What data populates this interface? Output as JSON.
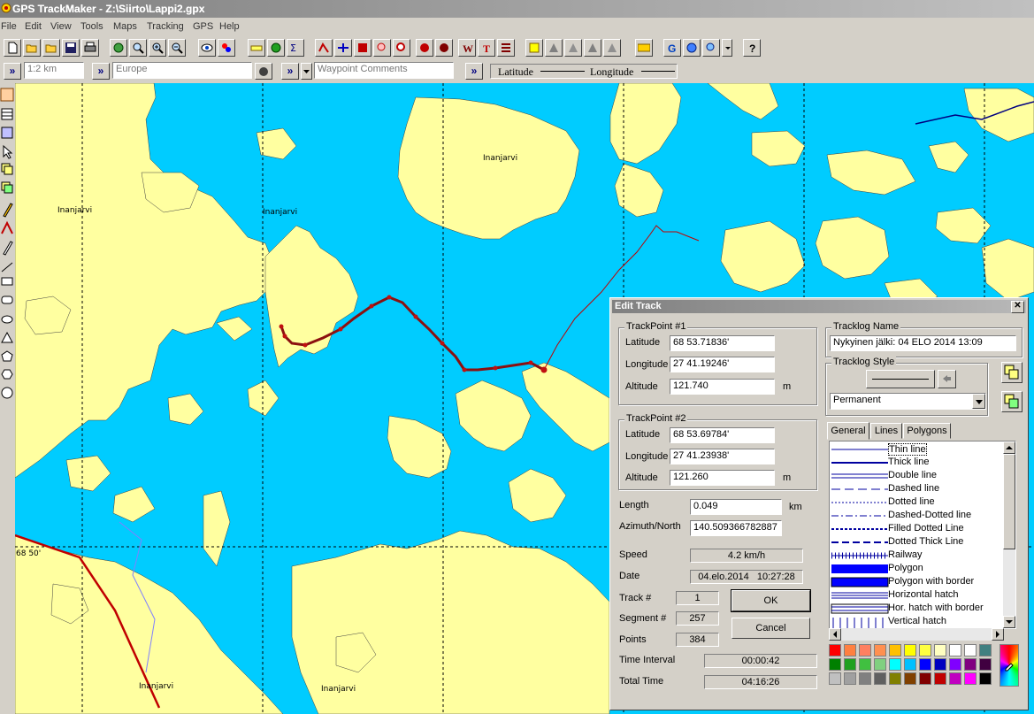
{
  "window": {
    "title": "GPS TrackMaker - Z:\\Siirto\\Lappi2.gpx"
  },
  "menu": [
    "File",
    "Edit",
    "View",
    "Tools",
    "Maps",
    "Tracking",
    "GPS",
    "Help"
  ],
  "addressbar": {
    "scale": "1:2 km",
    "region": "Europe",
    "waypoint_field": "Waypoint Comments",
    "latitude_label": "Latitude",
    "longitude_label": "Longitude"
  },
  "map": {
    "labels": [
      "Inanjarvi",
      "Inanjarvi",
      "Inanjarvi",
      "Inanjarvi",
      "Inanjarvi"
    ],
    "grid_label": "68 50'"
  },
  "dialog": {
    "title": "Edit Track",
    "tp1": {
      "title": "TrackPoint #1",
      "lat_label": "Latitude",
      "lat": "68 53.71836'",
      "lon_label": "Longitude",
      "lon": "27 41.19246'",
      "alt_label": "Altitude",
      "alt": "121.740",
      "alt_unit": "m"
    },
    "tp2": {
      "title": "TrackPoint #2",
      "lat_label": "Latitude",
      "lat": "68 53.69784'",
      "lon_label": "Longitude",
      "lon": "27 41.23938'",
      "alt_label": "Altitude",
      "alt": "121.260",
      "alt_unit": "m"
    },
    "length_label": "Length",
    "length": "0.049",
    "length_unit": "km",
    "azimuth_label": "Azimuth/North",
    "azimuth": "140.509366782887",
    "speed_label": "Speed",
    "speed": "4.2 km/h",
    "date_label": "Date",
    "date": "04.elo.2014   10:27:28",
    "track_label": "Track #",
    "track": "1",
    "segment_label": "Segment #",
    "segment": "257",
    "points_label": "Points",
    "points": "384",
    "interval_label": "Time Interval",
    "interval": "00:00:42",
    "total_label": "Total Time",
    "total": "04:16:26",
    "ok": "OK",
    "cancel": "Cancel",
    "tracklog_name_title": "Tracklog Name",
    "tracklog_name": "Nykyinen jälki: 04 ELO 2014 13:09",
    "tracklog_style_title": "Tracklog Style",
    "style_select": "Permanent",
    "tabs": [
      "General",
      "Lines",
      "Polygons"
    ],
    "styles": [
      "Thin line",
      "Thick line",
      "Double line",
      "Dashed line",
      "Dotted line",
      "Dashed-Dotted line",
      "Filled Dotted Line",
      "Dotted Thick Line",
      "Railway",
      "Polygon",
      "Polygon with border",
      "Horizontal hatch",
      "Hor. hatch with border",
      "Vertical hatch"
    ],
    "palette": [
      "#ff0000",
      "#ff8040",
      "#ff8060",
      "#ff9050",
      "#ffc000",
      "#ffff00",
      "#ffff40",
      "#ffffc0",
      "#ffffff",
      "#ffffff",
      "#408080",
      "#008000",
      "#20a020",
      "#40c040",
      "#80d080",
      "#00ffff",
      "#00c0ff",
      "#0000ff",
      "#0000c0",
      "#8000ff",
      "#800080",
      "#400040",
      "#c0c0c0",
      "#a0a0a0",
      "#808080",
      "#606060",
      "#808000",
      "#804000",
      "#800000",
      "#c00000",
      "#c000c0",
      "#ff00ff",
      "#000000"
    ]
  }
}
